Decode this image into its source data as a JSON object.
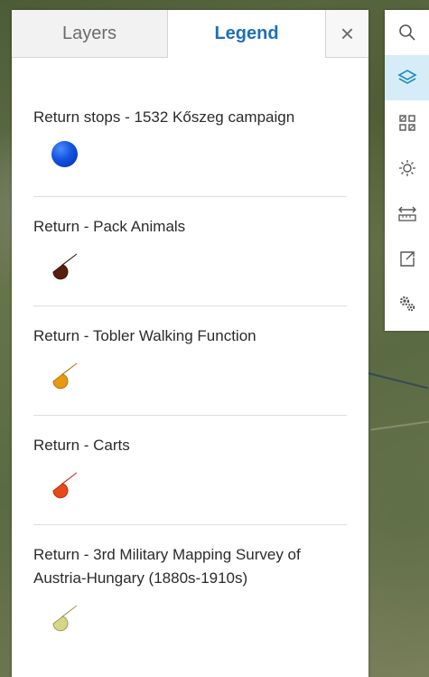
{
  "tabs": {
    "layers_label": "Layers",
    "legend_label": "Legend",
    "close_symbol": "×"
  },
  "legend": {
    "items": [
      {
        "label": "Return stops - 1532 Kőszeg campaign",
        "symbol": "point",
        "color": "#1252e0"
      },
      {
        "label": "Return - Pack Animals",
        "symbol": "teardrop",
        "color": "#5a1f0c"
      },
      {
        "label": "Return - Tobler Walking Function",
        "symbol": "teardrop",
        "color": "#e69a12"
      },
      {
        "label": "Return - Carts",
        "symbol": "teardrop",
        "color": "#e8481a"
      },
      {
        "label": "Return - 3rd Military Mapping Survey of Austria-Hungary (1880s-1910s)",
        "symbol": "teardrop",
        "color": "#d6d68a"
      }
    ]
  },
  "toolbar": {
    "tools": [
      {
        "icon": "search-icon",
        "active": false
      },
      {
        "icon": "layers-icon",
        "active": true
      },
      {
        "icon": "basemap-gallery-icon",
        "active": false
      },
      {
        "icon": "daylight-icon",
        "active": false
      },
      {
        "icon": "measure-icon",
        "active": false
      },
      {
        "icon": "share-icon",
        "active": false
      },
      {
        "icon": "settings-icon",
        "active": false
      }
    ],
    "active_color": "#1e8bc3"
  }
}
